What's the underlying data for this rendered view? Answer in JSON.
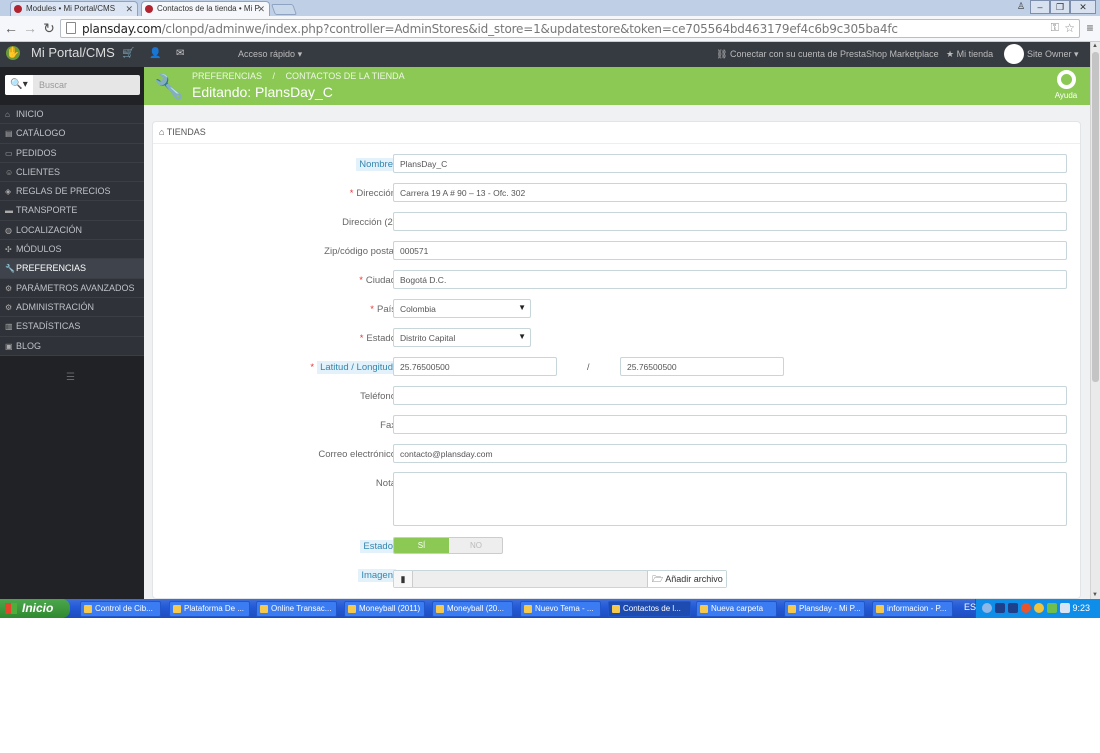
{
  "browser": {
    "tabs": [
      {
        "label": "Modules • Mi Portal/CMS",
        "active": false
      },
      {
        "label": "Contactos de la tienda • Mi P",
        "active": true
      }
    ],
    "url_domain": "plansday.com",
    "url_path": "/clonpd/adminwe/index.php?controller=AdminStores&id_store=1&updatestore&token=ce705564bd463179ef4c6b9c305ba4fc"
  },
  "admin_header": {
    "brand": "Mi Portal/CMS",
    "quick_access": "Acceso rápido",
    "marketplace": "Conectar con su cuenta de PrestaShop Marketplace",
    "my_store": "Mi tienda",
    "owner": "Site Owner"
  },
  "sidebar": {
    "search_placeholder": "Buscar",
    "items": [
      {
        "label": "INICIO",
        "icon": "home-icon"
      },
      {
        "label": "CATÁLOGO",
        "icon": "book-icon"
      },
      {
        "label": "PEDIDOS",
        "icon": "credit-card-icon"
      },
      {
        "label": "CLIENTES",
        "icon": "users-icon"
      },
      {
        "label": "REGLAS DE PRECIOS",
        "icon": "tags-icon"
      },
      {
        "label": "TRANSPORTE",
        "icon": "truck-icon"
      },
      {
        "label": "LOCALIZACIÓN",
        "icon": "globe-icon"
      },
      {
        "label": "MÓDULOS",
        "icon": "puzzle-icon"
      },
      {
        "label": "PREFERENCIAS",
        "icon": "wrench-icon",
        "active": true
      },
      {
        "label": "PARÁMETROS AVANZADOS",
        "icon": "cogs-icon"
      },
      {
        "label": "ADMINISTRACIÓN",
        "icon": "cog-icon"
      },
      {
        "label": "ESTADÍSTICAS",
        "icon": "bar-chart-icon"
      },
      {
        "label": "BLOG",
        "icon": "blog-icon"
      }
    ]
  },
  "toolbar": {
    "breadcrumb": [
      "PREFERENCIAS",
      "CONTACTOS DE LA TIENDA"
    ],
    "title": "Editando: PlansDay_C",
    "help": "Ayuda"
  },
  "panel": {
    "heading": "TIENDAS",
    "fields": {
      "nombre": {
        "label": "Nombre",
        "value": "PlansDay_C"
      },
      "direccion": {
        "label": "Dirección",
        "value": "Carrera 19 A # 90 – 13 - Ofc. 302",
        "required": true
      },
      "direccion2": {
        "label": "Dirección (2)",
        "value": ""
      },
      "zip": {
        "label": "Zip/código postal",
        "value": "000571"
      },
      "ciudad": {
        "label": "Ciudad",
        "value": "Bogotá D.C.",
        "required": true
      },
      "pais": {
        "label": "País",
        "value": "Colombia",
        "required": true
      },
      "estado_region": {
        "label": "Estado",
        "value": "Distrito Capital",
        "required": true
      },
      "latlong": {
        "label": "Latitud / Longitud",
        "lat": "25.76500500",
        "lng": "25.76500500",
        "sep": "/",
        "required": true
      },
      "telefono": {
        "label": "Teléfono",
        "value": ""
      },
      "fax": {
        "label": "Fax",
        "value": ""
      },
      "correo": {
        "label": "Correo electrónico",
        "value": "contacto@plansday.com"
      },
      "nota": {
        "label": "Nota",
        "value": ""
      },
      "estado": {
        "label": "Estado",
        "on": "SÍ",
        "off": "NO",
        "selected": "SÍ"
      },
      "imagen": {
        "label": "Imagen",
        "button": "Añadir archivo"
      }
    }
  },
  "taskbar": {
    "start": "Inicio",
    "items": [
      {
        "label": "Control de Cib..."
      },
      {
        "label": "Plataforma De ..."
      },
      {
        "label": "Online Transac..."
      },
      {
        "label": "Moneyball (2011)"
      },
      {
        "label": "Moneyball (20..."
      },
      {
        "label": "Nuevo Tema - ..."
      },
      {
        "label": "Contactos de l...",
        "active": true
      },
      {
        "label": "Nueva carpeta"
      },
      {
        "label": "Plansday - Mi P..."
      },
      {
        "label": "informacion - P..."
      }
    ],
    "lang": "ES",
    "clock": "9:23"
  }
}
